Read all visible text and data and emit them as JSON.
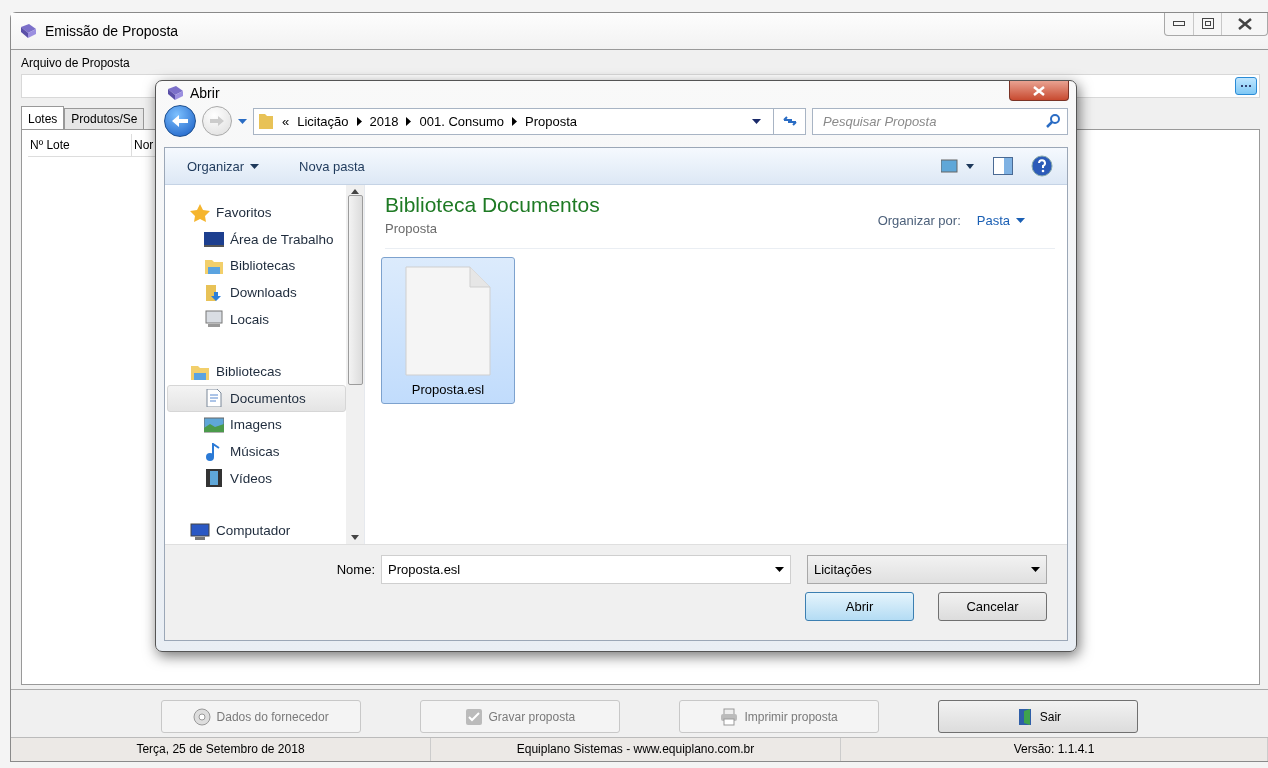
{
  "window": {
    "title": "Emissão de Proposta"
  },
  "file_field": {
    "label": "Arquivo de Proposta"
  },
  "tabs": [
    {
      "label": "Lotes",
      "selected": true
    },
    {
      "label": "Produtos/Se",
      "selected": false
    }
  ],
  "table": {
    "columns": [
      "Nº Lote",
      "Nor"
    ]
  },
  "buttons": [
    {
      "label": "Dados do fornecedor",
      "kind": "supplier",
      "disabled": true
    },
    {
      "label": "Gravar proposta",
      "kind": "save",
      "disabled": true
    },
    {
      "label": "Imprimir proposta",
      "kind": "print",
      "disabled": true
    },
    {
      "label": "Sair",
      "kind": "exit",
      "disabled": false
    }
  ],
  "status_bar": [
    "Terça, 25 de Setembro de 2018",
    "Equiplano Sistemas - www.equiplano.com.br",
    "Versão: 1.1.4.1"
  ],
  "dialog": {
    "title": "Abrir",
    "overflow": "«",
    "breadcrumb": [
      "Licitação",
      "2018",
      "001. Consumo",
      "Proposta"
    ],
    "search": {
      "placeholder": "Pesquisar Proposta"
    },
    "toolbar": [
      "Organizar",
      "Nova pasta"
    ],
    "nav": [
      {
        "label": "Favoritos",
        "kind": "star",
        "selected": false,
        "children": [
          {
            "label": "Área de Trabalho",
            "kind": "desktop",
            "selected": false
          },
          {
            "label": "Bibliotecas",
            "kind": "library",
            "selected": false
          },
          {
            "label": "Downloads",
            "kind": "downloads",
            "selected": false
          },
          {
            "label": "Locais",
            "kind": "places",
            "selected": false
          }
        ]
      },
      {
        "label": "Bibliotecas",
        "kind": "library",
        "selected": false,
        "children": [
          {
            "label": "Documentos",
            "kind": "documents",
            "selected": true
          },
          {
            "label": "Imagens",
            "kind": "images",
            "selected": false
          },
          {
            "label": "Músicas",
            "kind": "music",
            "selected": false
          },
          {
            "label": "Vídeos",
            "kind": "videos",
            "selected": false
          }
        ]
      },
      {
        "label": "Computador",
        "kind": "computer",
        "selected": false
      }
    ],
    "library": {
      "title": "Biblioteca Documentos",
      "subtitle": "Proposta",
      "arrange_label": "Organizar por:",
      "arrange_value": "Pasta"
    },
    "files": [
      {
        "name": "Proposta.esl",
        "selected": true
      }
    ],
    "filename": {
      "label": "Nome:",
      "value": "Proposta.esl"
    },
    "filter": "Licitações",
    "buttons": [
      {
        "label": "Abrir",
        "default": true
      },
      {
        "label": "Cancelar",
        "default": false
      }
    ]
  }
}
